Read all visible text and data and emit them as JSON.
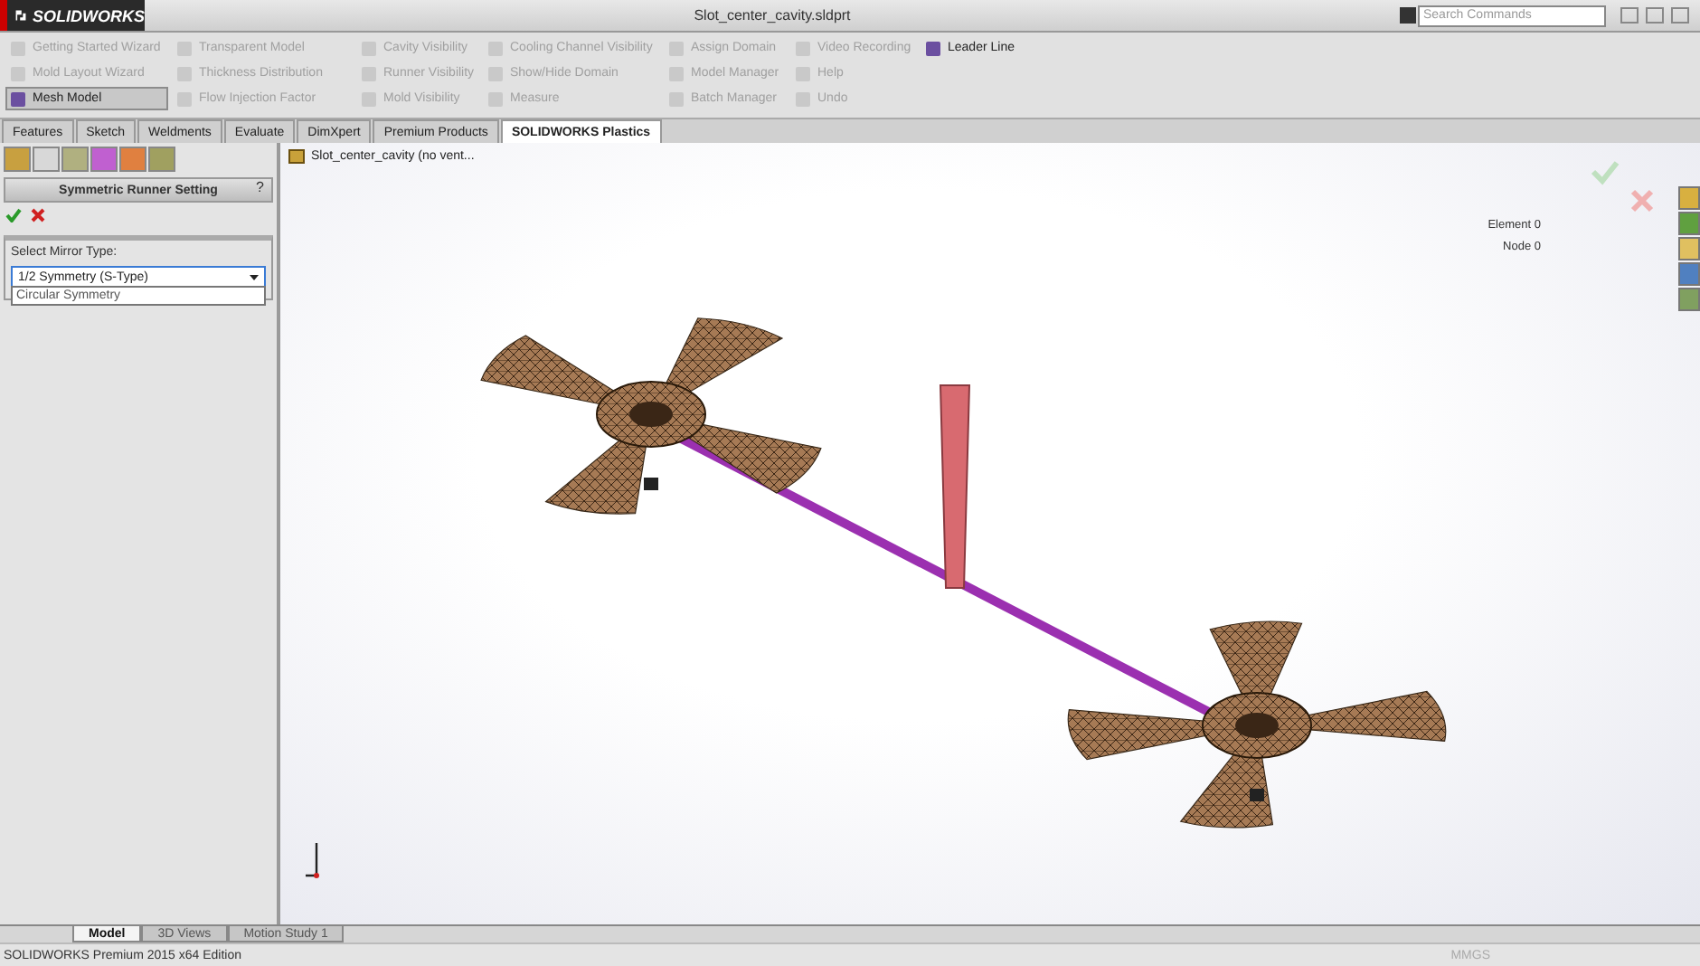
{
  "app": {
    "logo": "SOLIDWORKS",
    "document_title": "Slot_center_cavity.sldprt",
    "search": {
      "placeholder": "Search Commands"
    }
  },
  "ribbon": {
    "commands": [
      {
        "label": "Getting Started Wizard",
        "disabled": true,
        "selected": false
      },
      {
        "label": "Mold Layout Wizard",
        "disabled": true,
        "selected": false
      },
      {
        "label": "Mesh Model",
        "disabled": false,
        "selected": true
      },
      {
        "label": "Transparent Model",
        "disabled": true,
        "selected": false
      },
      {
        "label": "Thickness Distribution",
        "disabled": true,
        "selected": false
      },
      {
        "label": "Flow Injection Factor",
        "disabled": true,
        "selected": false
      },
      {
        "label": "Cavity Visibility",
        "disabled": true,
        "selected": false
      },
      {
        "label": "Runner Visibility",
        "disabled": true,
        "selected": false
      },
      {
        "label": "Mold Visibility",
        "disabled": true,
        "selected": false
      },
      {
        "label": "Cooling Channel Visibility",
        "disabled": true,
        "selected": false
      },
      {
        "label": "Show/Hide Domain",
        "disabled": true,
        "selected": false
      },
      {
        "label": "Measure",
        "disabled": true,
        "selected": false
      },
      {
        "label": "Assign Domain",
        "disabled": true,
        "selected": false
      },
      {
        "label": "Model Manager",
        "disabled": true,
        "selected": false
      },
      {
        "label": "Batch Manager",
        "disabled": true,
        "selected": false
      },
      {
        "label": "Video Recording",
        "disabled": true,
        "selected": false
      },
      {
        "label": "Help",
        "disabled": true,
        "selected": false
      },
      {
        "label": "Undo",
        "disabled": true,
        "selected": false
      },
      {
        "label": "Leader Line",
        "disabled": false,
        "selected": false
      }
    ]
  },
  "tabs": [
    {
      "label": "Features",
      "selected": false
    },
    {
      "label": "Sketch",
      "selected": false
    },
    {
      "label": "Weldments",
      "selected": false
    },
    {
      "label": "Evaluate",
      "selected": false
    },
    {
      "label": "DimXpert",
      "selected": false
    },
    {
      "label": "Premium Products",
      "selected": false
    },
    {
      "label": "SOLIDWORKS Plastics",
      "selected": true
    }
  ],
  "property_panel": {
    "title": "Symmetric Runner Setting",
    "help": "?",
    "mirror_type": {
      "label": "Select Mirror Type:",
      "value": "1/2 Symmetry (S-Type)",
      "options": [
        "Circular Symmetry"
      ]
    }
  },
  "viewport": {
    "tree_item": "Slot_center_cavity  (no vent...",
    "element_count": "Element 0",
    "node_count": "Node 0"
  },
  "bottom_tabs": [
    {
      "label": "Model",
      "selected": true
    },
    {
      "label": "3D Views",
      "selected": false
    },
    {
      "label": "Motion Study 1",
      "selected": false
    }
  ],
  "status_bar": {
    "edition": "SOLIDWORKS Premium 2015 x64 Edition",
    "units": "MMGS"
  }
}
